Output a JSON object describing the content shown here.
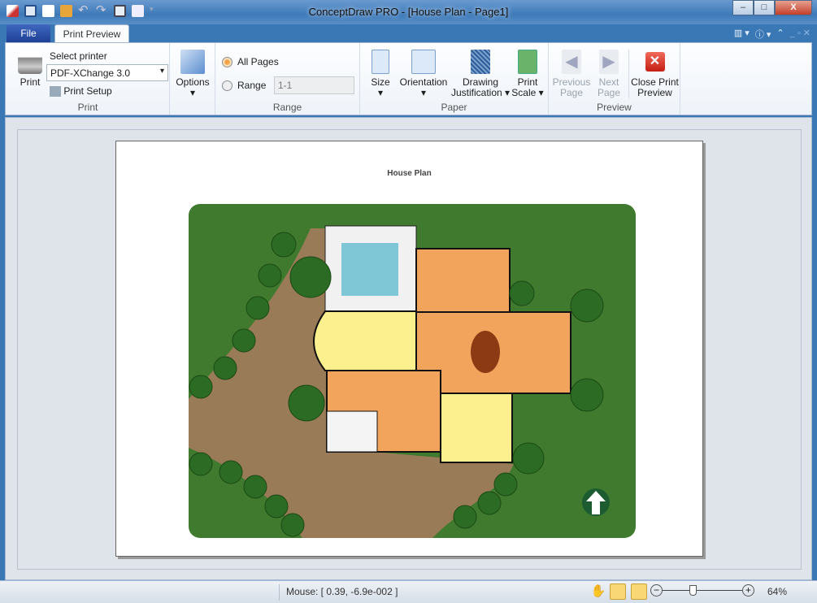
{
  "window": {
    "title": "ConceptDraw PRO - [House Plan - Page1]",
    "minimize": "–",
    "maximize": "□",
    "close": "X"
  },
  "quick_access": [
    "pen-icon",
    "panel-icon",
    "new-document-icon",
    "open-folder-icon",
    "undo-icon",
    "redo-icon",
    "save-icon",
    "print-preview-icon",
    "customize-dropdown-icon"
  ],
  "tabs": {
    "file": "File",
    "print_preview": "Print Preview"
  },
  "ribbon": {
    "print_group": {
      "label": "Print",
      "print_button": "Print",
      "select_printer_label": "Select printer",
      "printer_value": "PDF-XChange 3.0",
      "print_setup": "Print Setup",
      "options": "Options"
    },
    "range_group": {
      "label": "Range",
      "all_pages": "All Pages",
      "range": "Range",
      "range_value": "1-1",
      "selected": "All Pages"
    },
    "paper_group": {
      "label": "Paper",
      "size": "Size",
      "orientation": "Orientation",
      "drawing_justification_1": "Drawing",
      "drawing_justification_2": "Justification",
      "print_scale_1": "Print",
      "print_scale_2": "Scale"
    },
    "preview_group": {
      "label": "Preview",
      "previous_1": "Previous",
      "previous_2": "Page",
      "next_1": "Next",
      "next_2": "Page",
      "close_1": "Close Print",
      "close_2": "Preview"
    }
  },
  "page": {
    "title": "House Plan"
  },
  "status": {
    "mouse": "Mouse: [ 0.39, -6.9e-002 ]",
    "zoom": "64%",
    "zoom_fraction": 0.64,
    "minus": "−",
    "plus": "+"
  },
  "colors": {
    "lawn": "#3f7a2e",
    "stone": "#9a7b57",
    "floor_wood": "#f2a35c",
    "floor_yellow": "#fbef8e",
    "pool": "#7fc6d6",
    "accent": "#f5c342"
  }
}
